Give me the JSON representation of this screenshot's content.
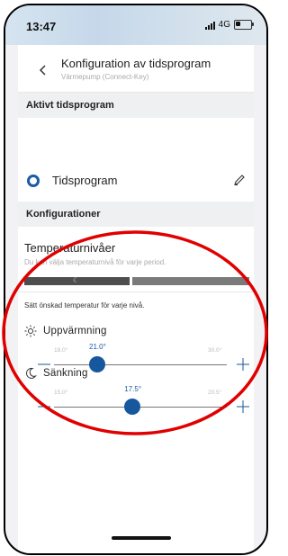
{
  "status": {
    "time": "13:47",
    "network": "4G"
  },
  "header": {
    "title": "Konfiguration av tidsprogram",
    "subtitle": "Värmepump (Connect-Key)"
  },
  "active_section": {
    "title": "Aktivt tidsprogram"
  },
  "program": {
    "label": "Tidsprogram",
    "selected": true
  },
  "config_section": {
    "title": "Konfigurationer"
  },
  "temperature": {
    "title": "Temperaturnivåer",
    "description": "Du kan välja temperaturnivå för varje period.",
    "instruction": "Sätt önskad temperatur för varje nivå."
  },
  "levels": [
    {
      "label": "Uppvärmning",
      "icon": "sun-icon",
      "min_label": "18.0°",
      "max_label": "30.0°",
      "value_label": "21.0°",
      "min": 18.0,
      "max": 30.0,
      "value": 21.0
    },
    {
      "label": "Sänkning",
      "icon": "moon-icon",
      "min_label": "15.0°",
      "max_label": "20.5°",
      "value_label": "17.5°",
      "min": 15.0,
      "max": 20.5,
      "value": 17.5
    }
  ],
  "colors": {
    "accent": "#17579d",
    "annotation": "#e00000",
    "section_bg": "#eff0f1"
  }
}
